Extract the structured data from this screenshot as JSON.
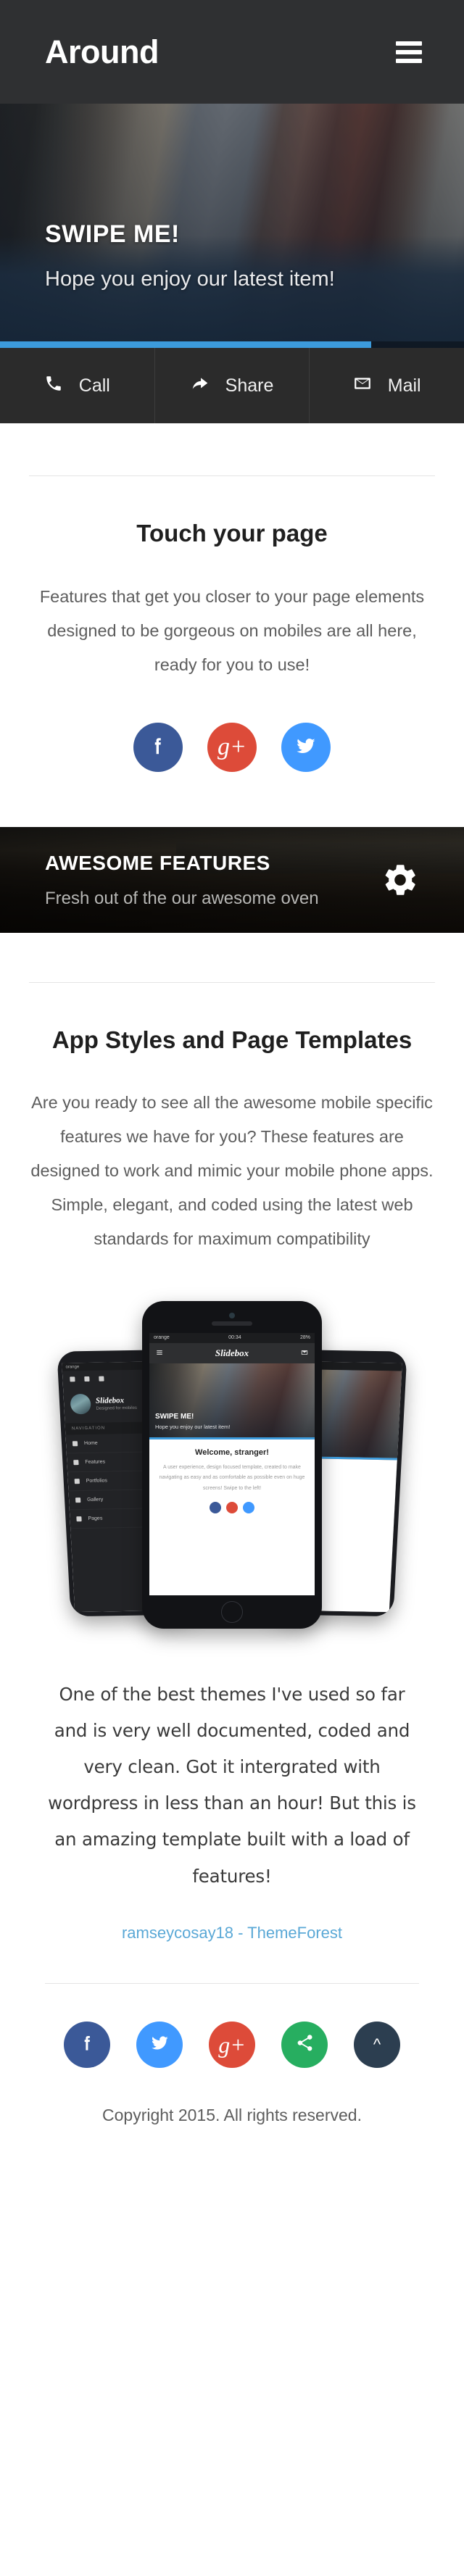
{
  "header": {
    "logo": "Around",
    "menu_icon": "hamburger-icon"
  },
  "hero": {
    "title": "SWIPE ME!",
    "subtitle": "Hope you enjoy our latest item!",
    "progress_percent": 80
  },
  "actionbar": {
    "items": [
      {
        "label": "Call",
        "icon": "phone-icon"
      },
      {
        "label": "Share",
        "icon": "share-arrow-icon"
      },
      {
        "label": "Mail",
        "icon": "envelope-icon"
      }
    ]
  },
  "touch_section": {
    "title": "Touch your page",
    "body": "Features that get you closer to your page elements designed to be gorgeous on mobiles are all here, ready for you to use!",
    "socials": [
      {
        "name": "facebook",
        "icon": "facebook-icon",
        "color": "#3b5998"
      },
      {
        "name": "googleplus",
        "icon": "google-plus-icon",
        "color": "#dd4b39"
      },
      {
        "name": "twitter",
        "icon": "twitter-icon",
        "color": "#4099ff"
      }
    ]
  },
  "banner": {
    "title": "AWESOME FEATURES",
    "subtitle": "Fresh out of the our awesome oven",
    "icon": "gear-icon"
  },
  "app_section": {
    "title": "App Styles and Page Templates",
    "body": "Are you ready to see all the awesome mobile specific features we have for you? These features are designed to work and mimic your mobile phone apps. Simple, elegant, and coded using the latest web standards for maximum compatibility"
  },
  "phone_mockup": {
    "status": {
      "carrier": "orange",
      "time": "00:34",
      "battery": "28%"
    },
    "nav": {
      "brand": "Slidebox",
      "menu_icon": "hamburger-icon",
      "mail_icon": "envelope-icon"
    },
    "hero": {
      "title": "SWIPE ME!",
      "subtitle": "Hope you enjoy our latest item!"
    },
    "content": {
      "heading": "Welcome, stranger!",
      "paragraph": "A user experience, design focused template, created to make navigating as easy and as comfortable as possible even on huge screens! Swipe to the left!"
    },
    "drawer": {
      "user_name": "Slidebox",
      "user_role": "Designed for mobiles",
      "section_label": "NAVIGATION",
      "items": [
        {
          "label": "Home",
          "icon": "home-icon"
        },
        {
          "label": "Features",
          "icon": "gear-icon"
        },
        {
          "label": "Portfolios",
          "icon": "image-icon"
        },
        {
          "label": "Gallery",
          "icon": "camera-icon"
        },
        {
          "label": "Pages",
          "icon": "file-icon"
        }
      ]
    }
  },
  "testimonial": {
    "quote": "One of the best themes I've used so far and is very well documented, coded and very clean. Got it intergrated with wordpress in less than an hour! But this is an amazing template built with a load of features!",
    "author": "ramseycosay18 - ThemeForest",
    "author_color": "#5aa8d6"
  },
  "footer": {
    "socials": [
      {
        "name": "facebook",
        "icon": "facebook-icon",
        "color": "#3b5998"
      },
      {
        "name": "twitter",
        "icon": "twitter-icon",
        "color": "#4099ff"
      },
      {
        "name": "googleplus",
        "icon": "google-plus-icon",
        "color": "#dd4b39"
      },
      {
        "name": "share",
        "icon": "share-nodes-icon",
        "color": "#27ae60"
      },
      {
        "name": "scrolltop",
        "icon": "chevron-up-icon",
        "color": "#2c3e50"
      }
    ],
    "copyright": "Copyright 2015. All rights reserved."
  }
}
